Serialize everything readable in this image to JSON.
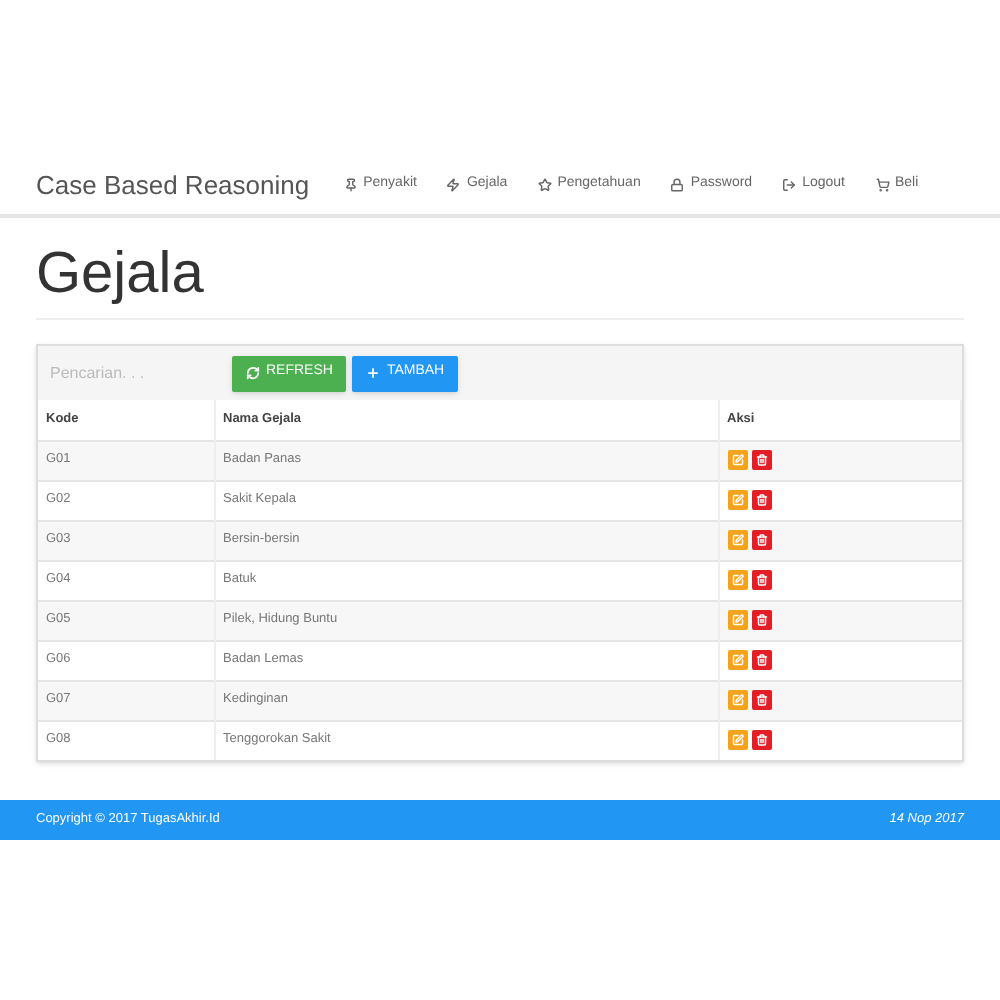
{
  "navbar": {
    "brand": "Case Based Reasoning",
    "items": [
      {
        "label": "Penyakit"
      },
      {
        "label": "Gejala"
      },
      {
        "label": "Pengetahuan"
      },
      {
        "label": "Password"
      },
      {
        "label": "Logout"
      },
      {
        "label": "Beli"
      }
    ]
  },
  "page_title": "Gejala",
  "toolbar": {
    "search": {
      "placeholder": "Pencarian. . ."
    },
    "buttons": [
      {
        "label": "REFRESH",
        "kind": "refresh"
      },
      {
        "label": "TAMBAH",
        "kind": "add"
      }
    ]
  },
  "table": {
    "columns": [
      "Kode",
      "Nama Gejala",
      "Aksi"
    ],
    "rows": [
      {
        "kode": "G01",
        "nama": "Badan Panas"
      },
      {
        "kode": "G02",
        "nama": "Sakit Kepala"
      },
      {
        "kode": "G03",
        "nama": "Bersin-bersin"
      },
      {
        "kode": "G04",
        "nama": "Batuk"
      },
      {
        "kode": "G05",
        "nama": "Pilek, Hidung Buntu"
      },
      {
        "kode": "G06",
        "nama": "Badan Lemas"
      },
      {
        "kode": "G07",
        "nama": "Kedinginan"
      },
      {
        "kode": "G08",
        "nama": "Tenggorokan Sakit"
      }
    ]
  },
  "footer": {
    "copyright": "Copyright © 2017 TugasAkhir.Id",
    "date": "14 Nop 2017"
  }
}
